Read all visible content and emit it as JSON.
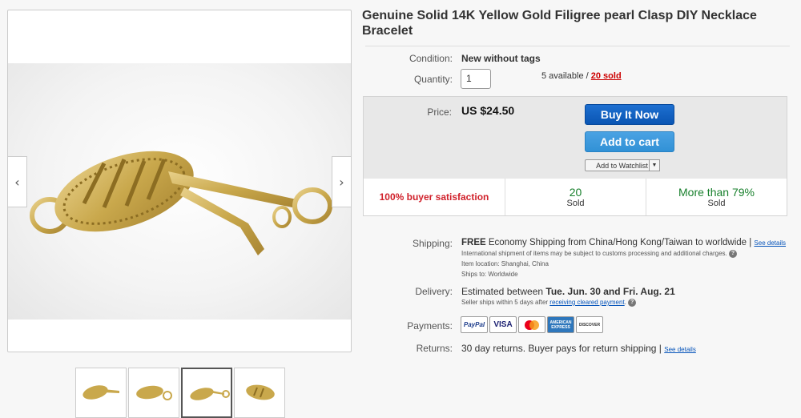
{
  "product": {
    "title": "Genuine Solid 14K Yellow Gold Filigree pearl Clasp DIY Necklace Bracelet",
    "condition_label": "Condition:",
    "condition_value": "New without tags",
    "quantity_label": "Quantity:",
    "quantity_value": "1",
    "available_text": "5 available / ",
    "sold_link": "20 sold"
  },
  "gallery": {
    "prev_glyph": "‹",
    "next_glyph": "›",
    "thumbnail_count": 4,
    "active_thumbnail": 3
  },
  "purchase": {
    "price_label": "Price:",
    "price_value": "US $24.50",
    "buy_now_label": "Buy It Now",
    "add_to_cart_label": "Add to cart",
    "watchlist_label": "Add to Watchlist",
    "watchlist_dropdown_glyph": "▼"
  },
  "stats": {
    "satisfaction": "100% buyer satisfaction",
    "sold_count": "20",
    "sold_label": "Sold",
    "more_than": "More than 79%",
    "more_than_label": "Sold"
  },
  "shipping": {
    "label": "Shipping:",
    "free": "FREE",
    "text": " Economy Shipping from China/Hong Kong/Taiwan to worldwide | ",
    "see_details": "See details",
    "note": "International shipment of items may be subject to customs processing and additional charges.",
    "item_location": "Item location:  Shanghai, China",
    "ships_to": "Ships to:  Worldwide"
  },
  "delivery": {
    "label": "Delivery:",
    "prefix": "Estimated between ",
    "dates": "Tue. Jun. 30 and Fri. Aug. 21",
    "note_prefix": "Seller ships within 5 days after ",
    "note_link": "receiving cleared payment",
    "note_suffix": "."
  },
  "payments": {
    "label": "Payments:",
    "methods": [
      "PayPal",
      "VISA",
      "MasterCard",
      "AMERICAN EXPRESS",
      "DISCOVER"
    ]
  },
  "returns": {
    "label": "Returns:",
    "text": "30 day returns. Buyer pays for return shipping | ",
    "see_details": "See details"
  },
  "colors": {
    "buy_now": "#0a55b3",
    "add_to_cart": "#3191d6",
    "satisfaction_red": "#d0202a",
    "stat_green": "#19802d",
    "gold": "#c9a84c"
  }
}
